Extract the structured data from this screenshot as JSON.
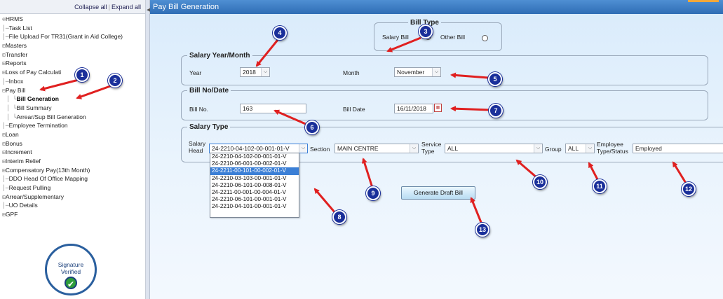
{
  "sidebar": {
    "collapse_all": "Collapse all",
    "expand_all": "Expand all",
    "separator": "|",
    "items": [
      {
        "prefix": "⊕",
        "label": "HRMS"
      },
      {
        "prefix": "│─",
        "label": "Task List"
      },
      {
        "prefix": "│─",
        "label": "File Upload For TR31(Grant in Aid College)"
      },
      {
        "prefix": "⊞",
        "label": "Masters"
      },
      {
        "prefix": "⊞",
        "label": "Transfer"
      },
      {
        "prefix": "⊞",
        "label": "Reports"
      },
      {
        "prefix": "⊞",
        "label": "Loss of Pay Calculati"
      },
      {
        "prefix": "│─",
        "label": "Inbox"
      },
      {
        "prefix": "⊟",
        "label": "Pay Bill"
      },
      {
        "prefix": "│ └",
        "label": "Bill Generation"
      },
      {
        "prefix": "│ └",
        "label": "Bill Summary"
      },
      {
        "prefix": "│ └",
        "label": "Arrear/Sup Bill Generation"
      },
      {
        "prefix": "│─",
        "label": "Employee Termination"
      },
      {
        "prefix": "⊞",
        "label": "Loan"
      },
      {
        "prefix": "⊞",
        "label": "Bonus"
      },
      {
        "prefix": "⊞",
        "label": "Increment"
      },
      {
        "prefix": "⊞",
        "label": "Interim Relief"
      },
      {
        "prefix": "⊞",
        "label": "Compensatory Pay(13th Month)"
      },
      {
        "prefix": "│─",
        "label": "DDO Head Of Office Mapping"
      },
      {
        "prefix": "│─",
        "label": "Request Pulling"
      },
      {
        "prefix": "⊞",
        "label": "Arrear/Supplementary"
      },
      {
        "prefix": "│─",
        "label": "UO Details"
      },
      {
        "prefix": "⊞",
        "label": "GPF"
      }
    ],
    "signature": {
      "line1": "Signature",
      "line2": "Verified",
      "check": "✔"
    }
  },
  "title": "Pay Bill Generation",
  "bill_type": {
    "legend": "Bill Type",
    "salary_bill": "Salary Bill",
    "other_bill": "Other Bill",
    "selected": "Salary Bill"
  },
  "salary_period": {
    "legend": "Salary Year/Month",
    "year_label": "Year",
    "year_value": "2018",
    "month_label": "Month",
    "month_value": "November"
  },
  "bill_no_date": {
    "legend": "Bill No/Date",
    "bill_no_label": "Bill No.",
    "bill_no_value": "163",
    "bill_date_label": "Bill Date",
    "bill_date_value": "16/11/2018"
  },
  "salary_type": {
    "legend": "Salary Type",
    "head_label_1": "Salary",
    "head_label_2": "Head",
    "head_value": "24-2210-04-102-00-001-01-V",
    "head_options": [
      "24-2210-04-102-00-001-01-V",
      "24-2210-06-001-00-002-01-V",
      "24-2211-00-101-00-002-01-V",
      "24-2210-03-103-00-001-01-V",
      "24-2210-06-101-00-008-01-V",
      "24-2211-00-001-00-004-01-V",
      "24-2210-06-101-00-001-01-V",
      "24-2210-04-101-00-001-01-V"
    ],
    "head_highlighted_index": 2,
    "section_label": "Section",
    "section_value": "MAIN CENTRE",
    "service_label_1": "Service",
    "service_label_2": "Type",
    "service_value": "ALL",
    "group_label": "Group",
    "group_value": "ALL",
    "emp_label_1": "Employee",
    "emp_label_2": "Type/Status",
    "emp_value": "Employed"
  },
  "generate_button": "Generate Draft Bill",
  "annotations": [
    "1",
    "2",
    "3",
    "4",
    "5",
    "6",
    "7",
    "8",
    "9",
    "10",
    "11",
    "12",
    "13"
  ],
  "colors": {
    "arrow": "#e02020",
    "badge": "#1a2f9a",
    "titlebar": "#3a78c2"
  }
}
